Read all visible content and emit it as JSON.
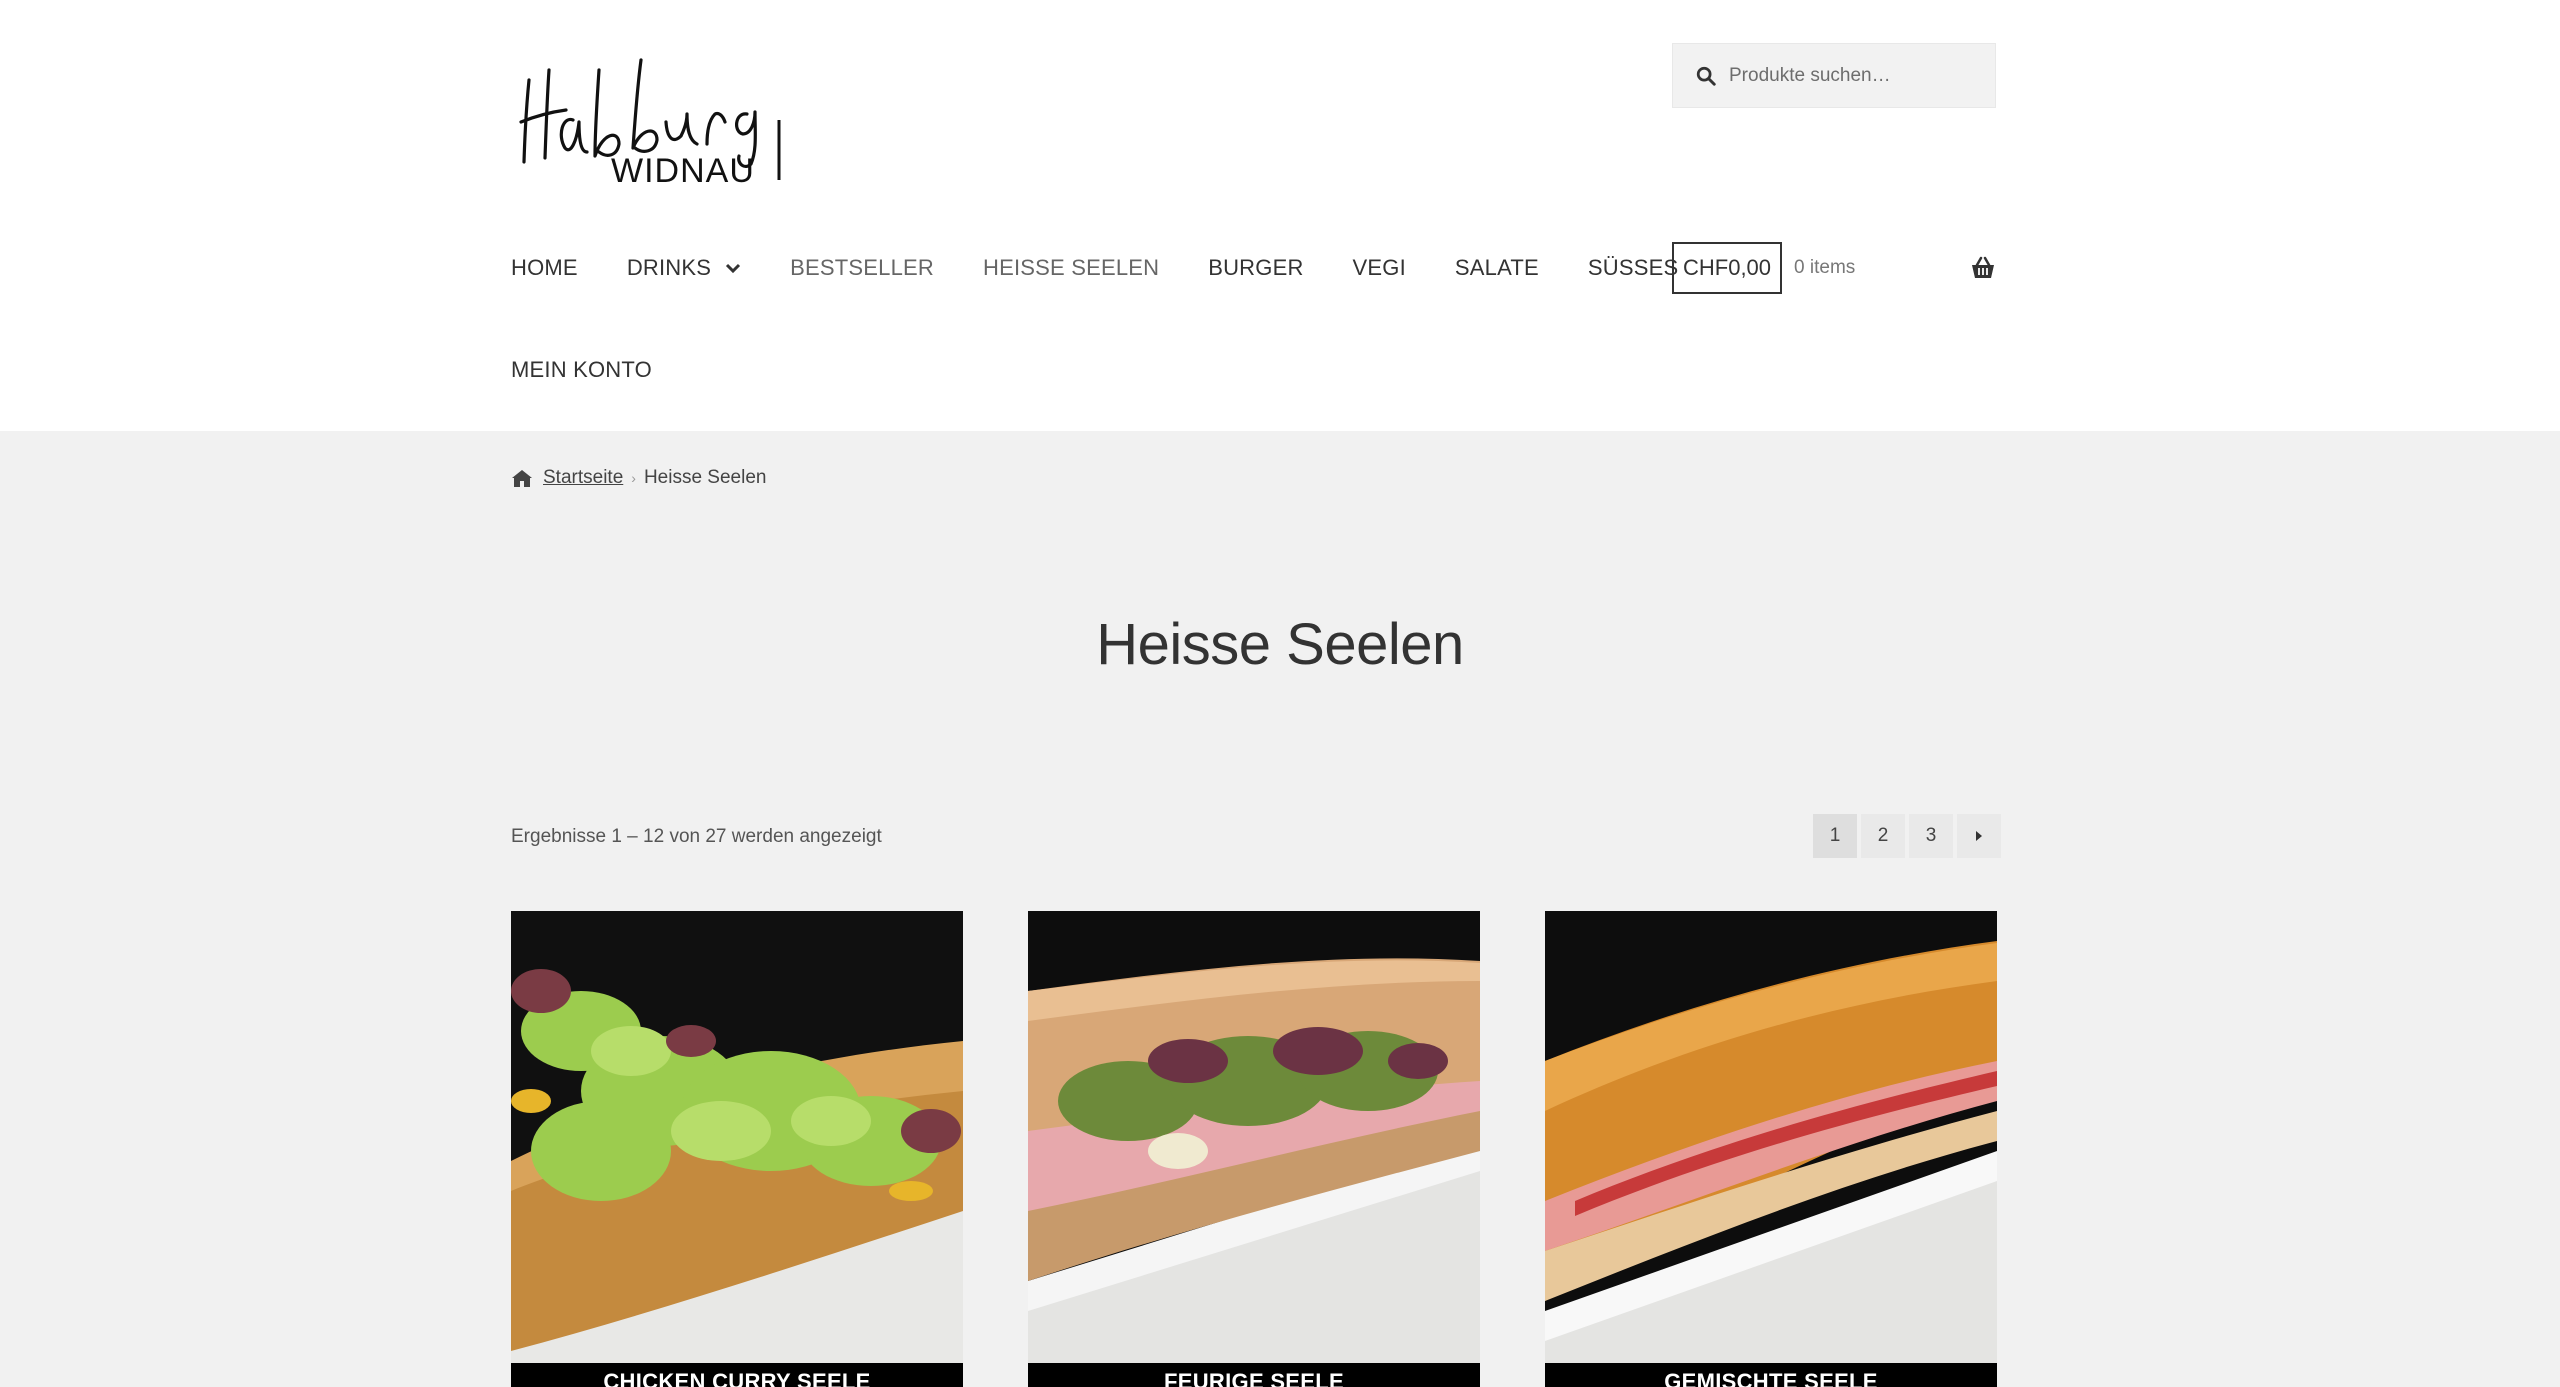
{
  "header": {
    "logo": {
      "top_text": "Habsburg",
      "bottom_text": "WIDNAU"
    },
    "search": {
      "placeholder": "Produkte suchen…"
    },
    "nav": [
      {
        "label": "HOME",
        "muted": false
      },
      {
        "label": "DRINKS",
        "muted": false,
        "has_dropdown": true
      },
      {
        "label": "BESTSELLER",
        "muted": true
      },
      {
        "label": "HEISSE SEELEN",
        "muted": true
      },
      {
        "label": "BURGER",
        "muted": false
      },
      {
        "label": "VEGI",
        "muted": false
      },
      {
        "label": "SALATE",
        "muted": false
      },
      {
        "label": "SÜSSES",
        "muted": false
      }
    ],
    "nav_second_row": "MEIN KONTO",
    "cart": {
      "total": "CHF0,00",
      "count": "0 items",
      "icon": "basket-icon"
    }
  },
  "breadcrumb": {
    "home_icon": "home-icon",
    "home_label": "Startseite",
    "current": "Heisse Seelen"
  },
  "page_title": "Heisse Seelen",
  "result_count": "Ergebnisse 1 – 12 von 27 werden angezeigt",
  "pagination": {
    "pages": [
      "1",
      "2",
      "3"
    ],
    "current": "1",
    "next_icon": "caret-right-icon"
  },
  "products": [
    {
      "title": "CHICKEN CURRY SEELE"
    },
    {
      "title": "FEURIGE SEELE"
    },
    {
      "title": "GEMISCHTE SEELE"
    }
  ],
  "colors": {
    "header_bg": "#ffffff",
    "main_bg": "#f1f1f1",
    "text": "#333333",
    "product_title_bg": "#000000"
  }
}
